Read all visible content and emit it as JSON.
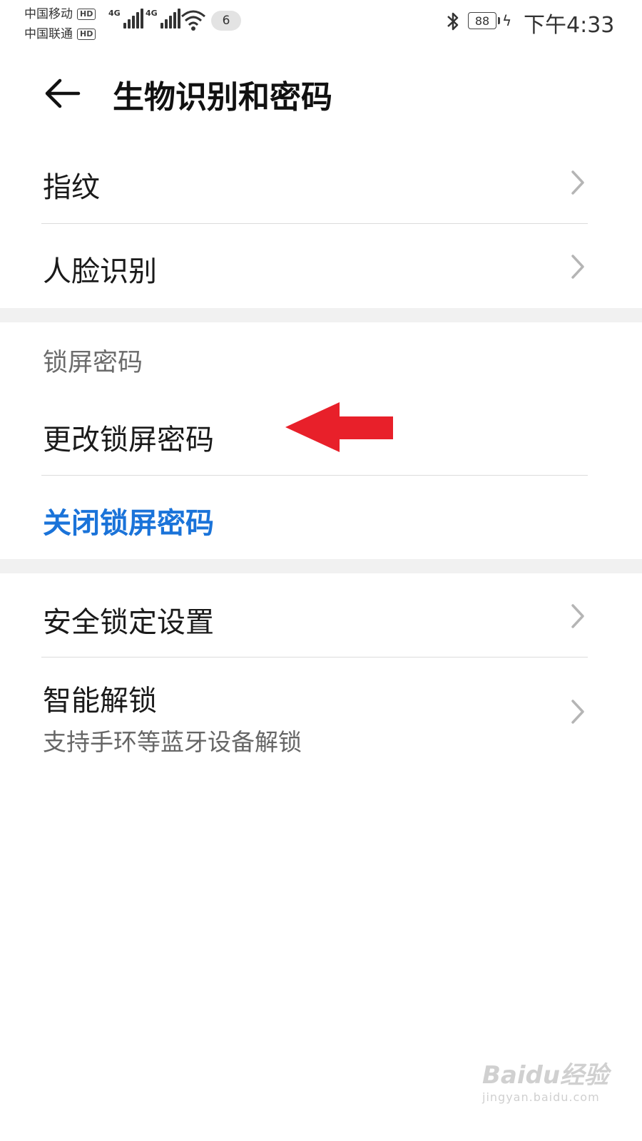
{
  "status_bar": {
    "carrier_1": "中国移动",
    "carrier_2": "中国联通",
    "hd_badge": "HD",
    "network_1": "4G",
    "network_2": "4G",
    "notification_count": "6",
    "battery_level": "88",
    "time": "下午4:33"
  },
  "header": {
    "title": "生物识别和密码"
  },
  "biometrics": {
    "fingerprint": "指纹",
    "face_recognition": "人脸识别"
  },
  "lock_screen": {
    "section_title": "锁屏密码",
    "change_password": "更改锁屏密码",
    "disable_password": "关闭锁屏密码",
    "accent_color": "#1a73d9"
  },
  "security": {
    "secure_lock_settings": "安全锁定设置",
    "smart_unlock": "智能解锁",
    "smart_unlock_desc": "支持手环等蓝牙设备解锁"
  },
  "annotation": {
    "arrow_color": "#e8202a"
  },
  "watermark": {
    "brand": "Baidu经验",
    "url": "jingyan.baidu.com"
  }
}
